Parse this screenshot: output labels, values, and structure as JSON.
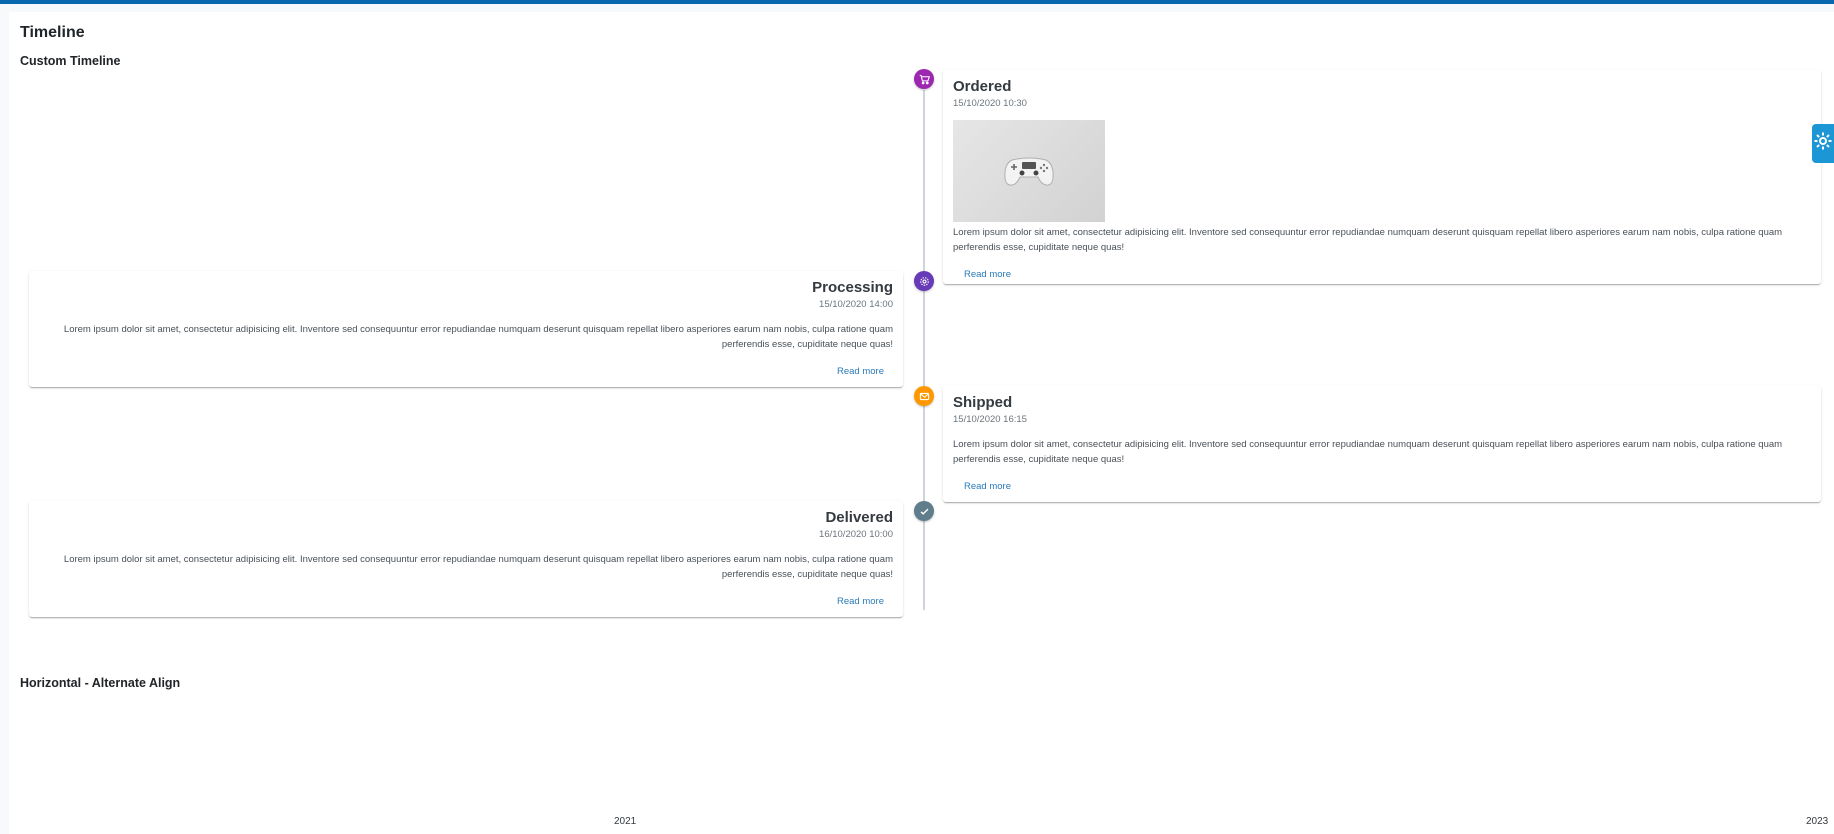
{
  "page_title": "Timeline",
  "sections": {
    "custom": "Custom Timeline",
    "horizontal": "Horizontal - Alternate Align"
  },
  "events": [
    {
      "title": "Ordered",
      "date": "15/10/2020 10:30",
      "icon": "shopping-cart-icon",
      "color": "#9c27b0",
      "text": "Lorem ipsum dolor sit amet, consectetur adipisicing elit. Inventore sed consequuntur error repudiandae numquam deserunt quisquam repellat libero asperiores earum nam nobis, culpa ratione quam perferendis esse, cupiditate neque quas!",
      "link": "Read more"
    },
    {
      "title": "Processing",
      "date": "15/10/2020 14:00",
      "icon": "cog-icon",
      "color": "#673ab7",
      "text": "Lorem ipsum dolor sit amet, consectetur adipisicing elit. Inventore sed consequuntur error repudiandae numquam deserunt quisquam repellat libero asperiores earum nam nobis, culpa ratione quam perferendis esse, cupiditate neque quas!",
      "link": "Read more"
    },
    {
      "title": "Shipped",
      "date": "15/10/2020 16:15",
      "icon": "envelope-icon",
      "color": "#ff9800",
      "text": "Lorem ipsum dolor sit amet, consectetur adipisicing elit. Inventore sed consequuntur error repudiandae numquam deserunt quisquam repellat libero asperiores earum nam nobis, culpa ratione quam perferendis esse, cupiditate neque quas!",
      "link": "Read more"
    },
    {
      "title": "Delivered",
      "date": "16/10/2020 10:00",
      "icon": "check-icon",
      "color": "#607d8b",
      "text": "Lorem ipsum dolor sit amet, consectetur adipisicing elit. Inventore sed consequuntur error repudiandae numquam deserunt quisquam repellat libero asperiores earum nam nobis, culpa ratione quam perferendis esse, cupiditate neque quas!",
      "link": "Read more"
    }
  ],
  "horizontal_years": [
    "2021",
    "2023"
  ],
  "colors": {
    "topbar": "#0868b0",
    "link": "#2a7ab8",
    "settings_tab": "#1c96d4"
  },
  "settings_icon": "gear-icon",
  "product_image": "gamepad-image"
}
